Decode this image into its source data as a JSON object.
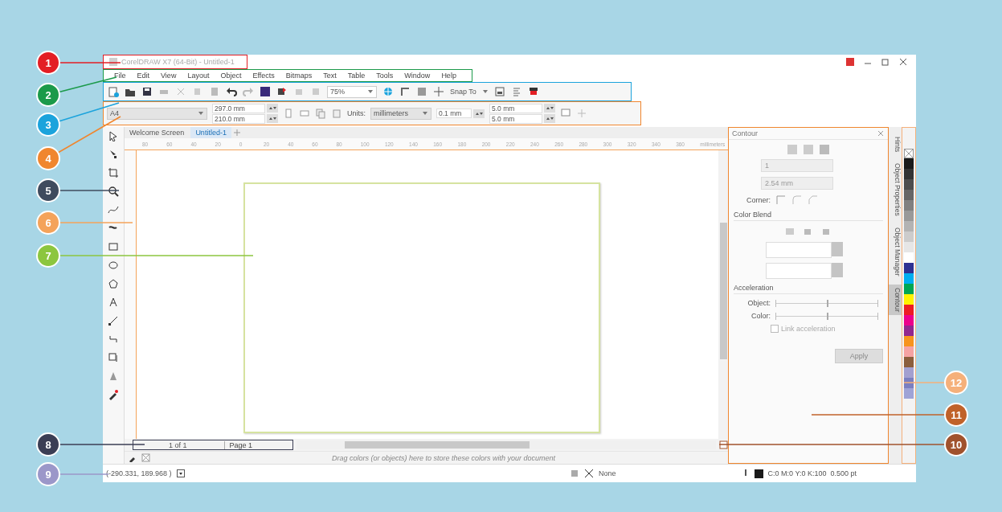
{
  "window": {
    "title": "CorelDRAW X7 (64-Bit) - Untitled-1"
  },
  "menu": [
    "File",
    "Edit",
    "View",
    "Layout",
    "Object",
    "Effects",
    "Bitmaps",
    "Text",
    "Table",
    "Tools",
    "Window",
    "Help"
  ],
  "toolbar": {
    "zoom": "75%",
    "snap": "Snap To"
  },
  "property_bar": {
    "page_size": "A4",
    "width": "297.0 mm",
    "height": "210.0 mm",
    "units_label": "Units:",
    "units": "millimeters",
    "nudge": "0.1 mm",
    "dup_x": "5.0 mm",
    "dup_y": "5.0 mm"
  },
  "doc_tabs": [
    {
      "label": "Welcome Screen",
      "selected": false
    },
    {
      "label": "Untitled-1",
      "selected": true
    }
  ],
  "ruler": {
    "ticks": [
      "80",
      "60",
      "40",
      "20",
      "0",
      "20",
      "40",
      "60",
      "80",
      "100",
      "120",
      "140",
      "160",
      "180",
      "200",
      "220",
      "240",
      "260",
      "280",
      "300",
      "320",
      "340",
      "360"
    ],
    "unit": "millimeters"
  },
  "page_nav": {
    "position": "1 of 1",
    "page_tab": "Page 1"
  },
  "document_palette": {
    "hint": "Drag colors (or objects) here to store these colors with your document"
  },
  "docker": {
    "title": "Contour",
    "steps": "1",
    "offset": "2.54 mm",
    "corner_label": "Corner:",
    "color_blend": "Color Blend",
    "acceleration": "Acceleration",
    "object_label": "Object:",
    "object_slider": {
      "level": 0.5
    },
    "color_label": "Color:",
    "color_slider": {
      "level": 0.5
    },
    "link": {
      "label": "Link acceleration",
      "checked": false
    },
    "apply": {
      "label": "Apply",
      "disabled": true
    }
  },
  "docker_tabs": [
    {
      "label": "Hints",
      "selected": false
    },
    {
      "label": "Object Properties",
      "selected": false
    },
    {
      "label": "Object Manager",
      "selected": false
    },
    {
      "label": "Contour",
      "selected": true
    }
  ],
  "palette": [
    {
      "color": "#1a1a1a"
    },
    {
      "color": "#333333"
    },
    {
      "color": "#4d4d4d"
    },
    {
      "color": "#666666"
    },
    {
      "color": "#808080"
    },
    {
      "color": "#999999"
    },
    {
      "color": "#b3b3b3"
    },
    {
      "color": "#cccccc"
    },
    {
      "color": "#e6e6e6"
    },
    {
      "color": "#ffffff"
    },
    {
      "color": "#2e3192"
    },
    {
      "color": "#00aeef"
    },
    {
      "color": "#00a651"
    },
    {
      "color": "#fff200"
    },
    {
      "color": "#ed1c24"
    },
    {
      "color": "#ec008c"
    },
    {
      "color": "#92278f"
    },
    {
      "color": "#f7941d"
    },
    {
      "color": "#f5a3a3"
    },
    {
      "color": "#8b5e3c"
    },
    {
      "color": "#a3a0d0"
    },
    {
      "color": "#7b7fc0"
    },
    {
      "color": "#9fa3d6"
    }
  ],
  "status_bar": {
    "coords": "(-290.331, 189.968 )",
    "fill": "None",
    "outline": "C:0 M:0 Y:0 K:100  0.500 pt"
  },
  "callouts": [
    {
      "label": "1",
      "color": "#e31e24"
    },
    {
      "label": "2",
      "color": "#1b9a4a"
    },
    {
      "label": "3",
      "color": "#1ba3dc"
    },
    {
      "label": "4",
      "color": "#f0862e"
    },
    {
      "label": "5",
      "color": "#3f4b5e"
    },
    {
      "label": "6",
      "color": "#f4a35a"
    },
    {
      "label": "7",
      "color": "#8cc63f"
    },
    {
      "label": "8",
      "color": "#3b3e54"
    },
    {
      "label": "9",
      "color": "#9b97c9"
    },
    {
      "label": "12",
      "color": "#f5b07a"
    },
    {
      "label": "11",
      "color": "#c0622a"
    },
    {
      "label": "10",
      "color": "#a0522d"
    }
  ]
}
